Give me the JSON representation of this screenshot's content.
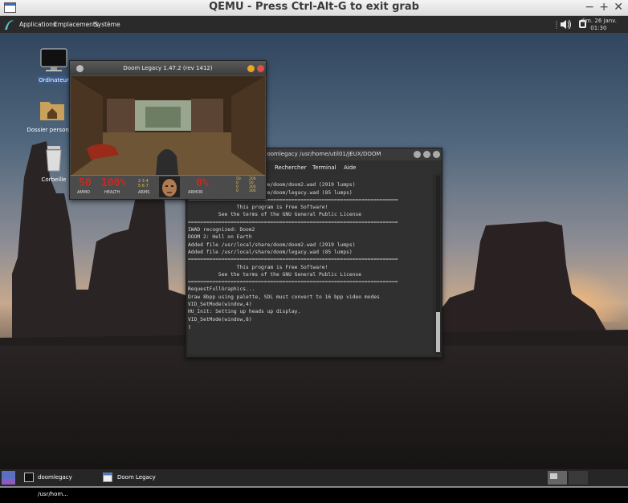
{
  "qemu": {
    "title": "QEMU - Press Ctrl-Alt-G to exit grab",
    "min": "−",
    "max": "+",
    "close": "✕"
  },
  "panel": {
    "menus": [
      "Applications",
      "Emplacements",
      "Système"
    ],
    "date": "dim. 26 janv.",
    "time": "01:30"
  },
  "desktop": {
    "icons": [
      "Ordinateur",
      "Dossier personnel",
      "Corbeille"
    ]
  },
  "doom": {
    "title": "Doom Legacy 1.47.2 (rev 1412)",
    "ammo": "50",
    "ammo_label": "AMMO",
    "health": "100%",
    "health_label": "HEALTH",
    "arms_label": "ARMS",
    "armor": "0%",
    "armor_label": "ARMOR",
    "arms": [
      "2",
      "3",
      "4",
      "5",
      "6",
      "7"
    ],
    "ammo_counts": [
      "50",
      "0",
      "0",
      "0"
    ],
    "ammo_max": [
      "200",
      "50",
      "300",
      "300"
    ]
  },
  "terminal": {
    "title": "doomlegacy /usr/home/util01/JEUX/DOOM",
    "menus": [
      "Rechercher",
      "Terminal",
      "Aide"
    ],
    "lines": [
      "DOOM 2: Hell on Earth",
      "Added file /usr/local/share/doom/doom2.wad (2919 lumps)",
      "Added file /usr/local/share/doom/legacy.wad (85 lumps)",
      "=====================================================================",
      "                This program is Free Software!",
      "          See the terms of the GNU General Public License",
      "=====================================================================",
      "IWAD recognized: Doom2",
      "DOOM 2: Hell on Earth",
      "Added file /usr/local/share/doom/doom2.wad (2919 lumps)",
      "Added file /usr/local/share/doom/legacy.wad (85 lumps)",
      "=====================================================================",
      "                This program is Free Software!",
      "          See the terms of the GNU General Public License",
      "=====================================================================",
      "RequestFullGraphics...",
      "Draw 8bpp using palette, SDL must convert to 16 bpp video modes",
      "VID_SetMode(window,4)",
      "HU_Init: Setting up heads up display.",
      "VID_SetMode(window,8)",
      "▯"
    ]
  },
  "taskbar": {
    "items": [
      "doomlegacy /usr/hom...",
      "Doom Legacy"
    ]
  },
  "colors": {
    "panel": "#2a2a2a",
    "terminal_bg": "#303030",
    "doom_red": "#c82a1e"
  }
}
